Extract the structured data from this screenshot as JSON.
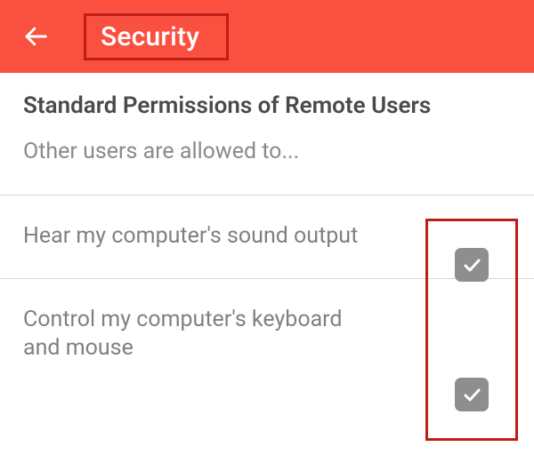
{
  "header": {
    "title": "Security",
    "accent_color": "#fa5040",
    "highlight_border_color": "#be1f15"
  },
  "section": {
    "heading": "Standard Permissions of Remote Users",
    "subtitle": "Other users are allowed to..."
  },
  "permissions": [
    {
      "label": "Hear my computer's sound output",
      "checked": true
    },
    {
      "label": "Control my computer's keyboard and mouse",
      "checked": true
    }
  ]
}
